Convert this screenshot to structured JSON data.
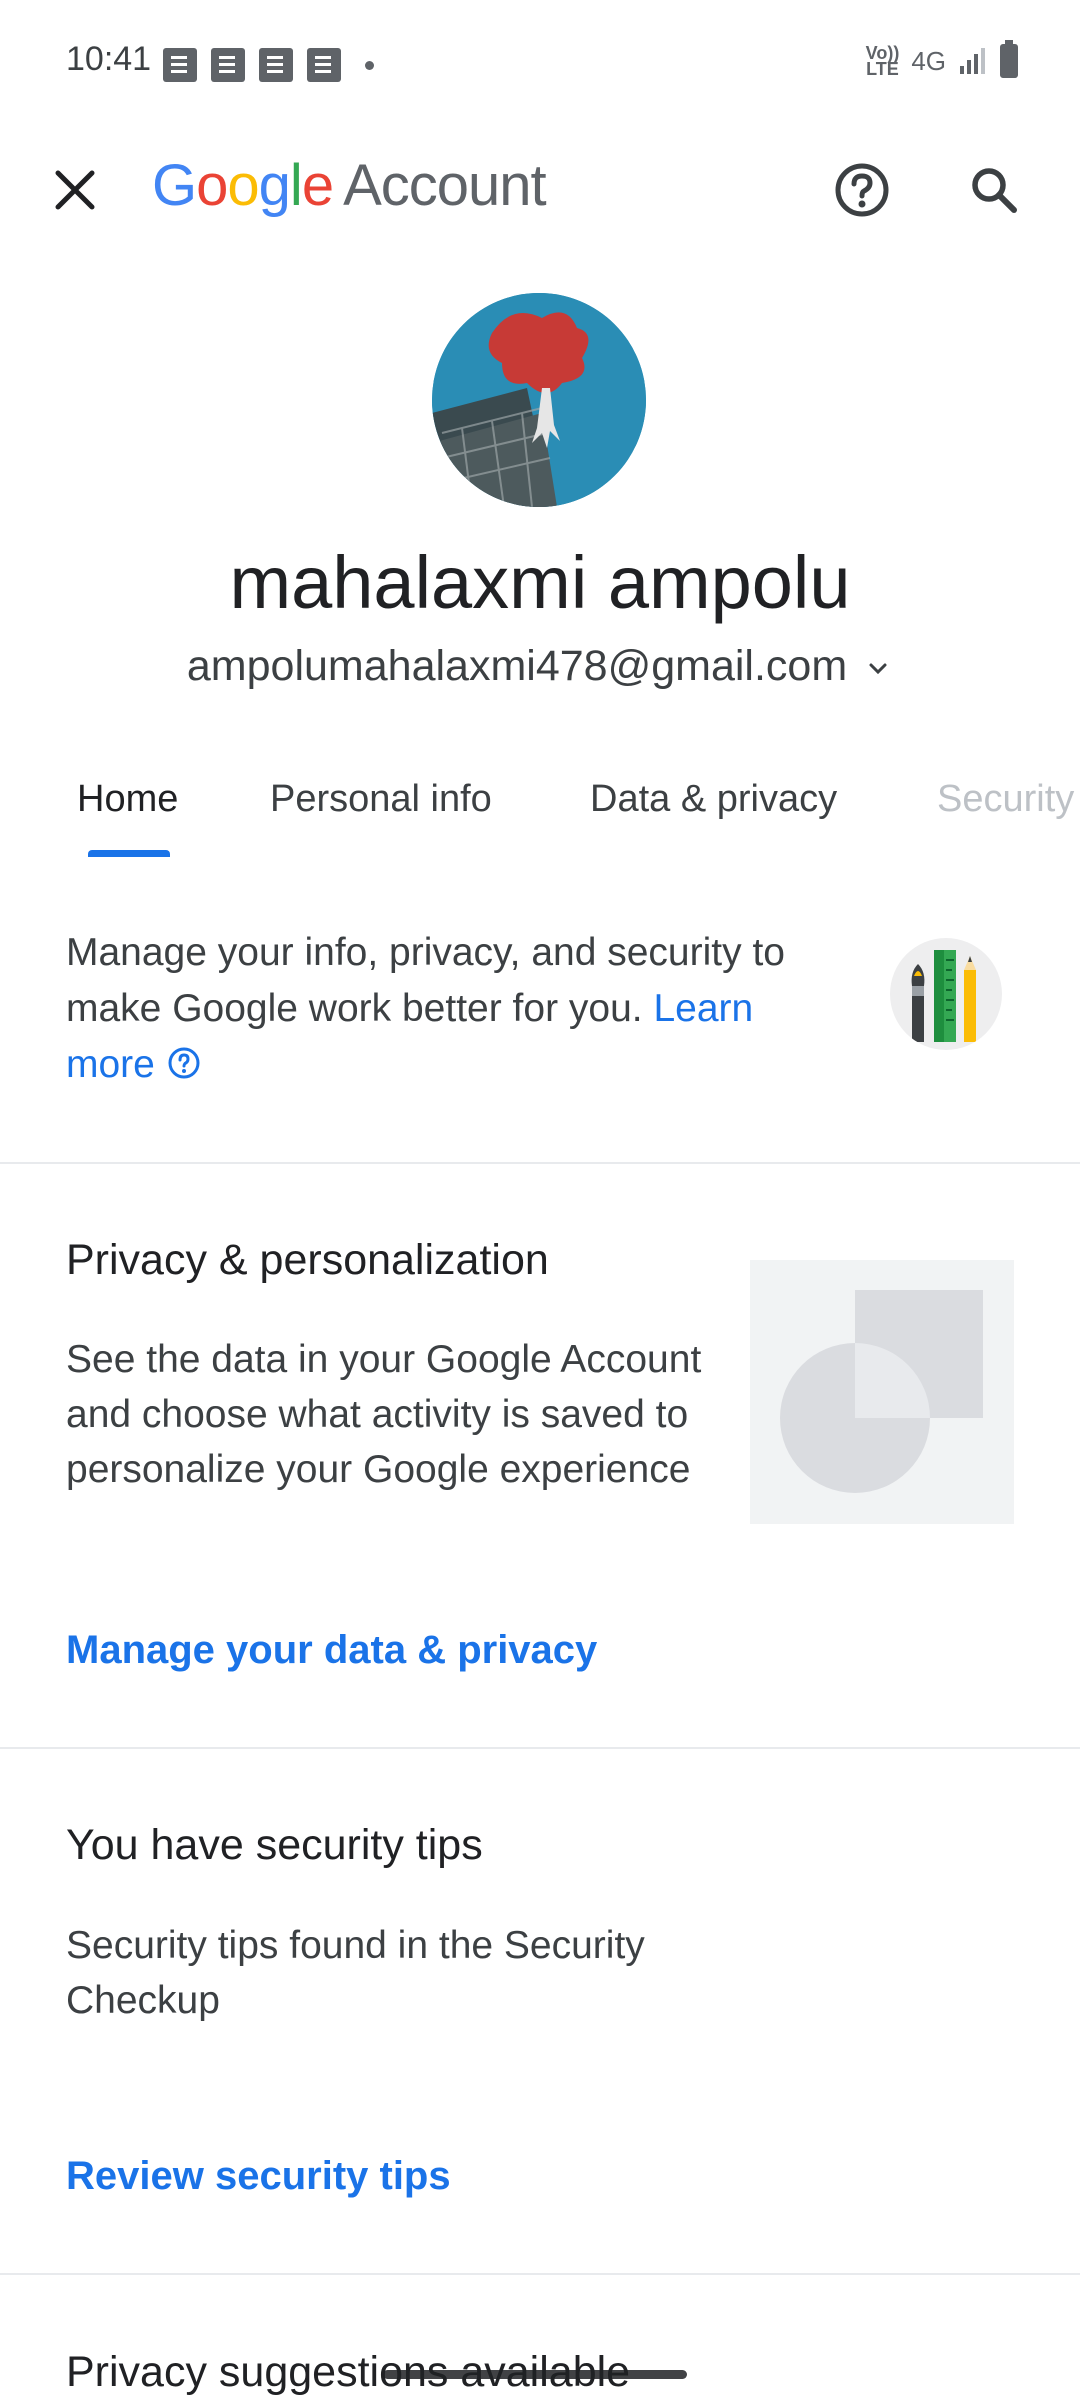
{
  "status_bar": {
    "time": "10:41",
    "network": "4G",
    "volte_top": "Vo))",
    "volte_bottom": "LTE"
  },
  "app_bar": {
    "brand_letters": [
      "G",
      "o",
      "o",
      "g",
      "l",
      "e"
    ],
    "brand_suffix": "Account"
  },
  "profile": {
    "name": "mahalaxmi ampolu",
    "email": "ampolumahalaxmi478@gmail.com"
  },
  "tabs": [
    {
      "label": "Home",
      "active": true
    },
    {
      "label": "Personal info"
    },
    {
      "label": "Data & privacy"
    },
    {
      "label": "Security"
    }
  ],
  "intro": {
    "text": "Manage your info, privacy, and security to make Google work better for you.",
    "learn_more": "Learn more"
  },
  "cards": [
    {
      "title": "Privacy & personalization",
      "description": "See the data in your Google Account and choose what activity is saved to personalize your Google experience",
      "link": "Manage your data & privacy"
    },
    {
      "title": "You have security tips",
      "description": "Security tips found in the Security Checkup",
      "link": "Review security tips"
    },
    {
      "title": "Privacy suggestions available"
    }
  ],
  "colors": {
    "accent": "#1a73e8",
    "google_blue": "#4285F4",
    "google_red": "#EA4335",
    "google_yellow": "#FBBC05",
    "google_green": "#34A853"
  },
  "icons": [
    "close-icon",
    "help-icon",
    "search-icon",
    "chevron-down-icon",
    "help-circle-icon"
  ]
}
